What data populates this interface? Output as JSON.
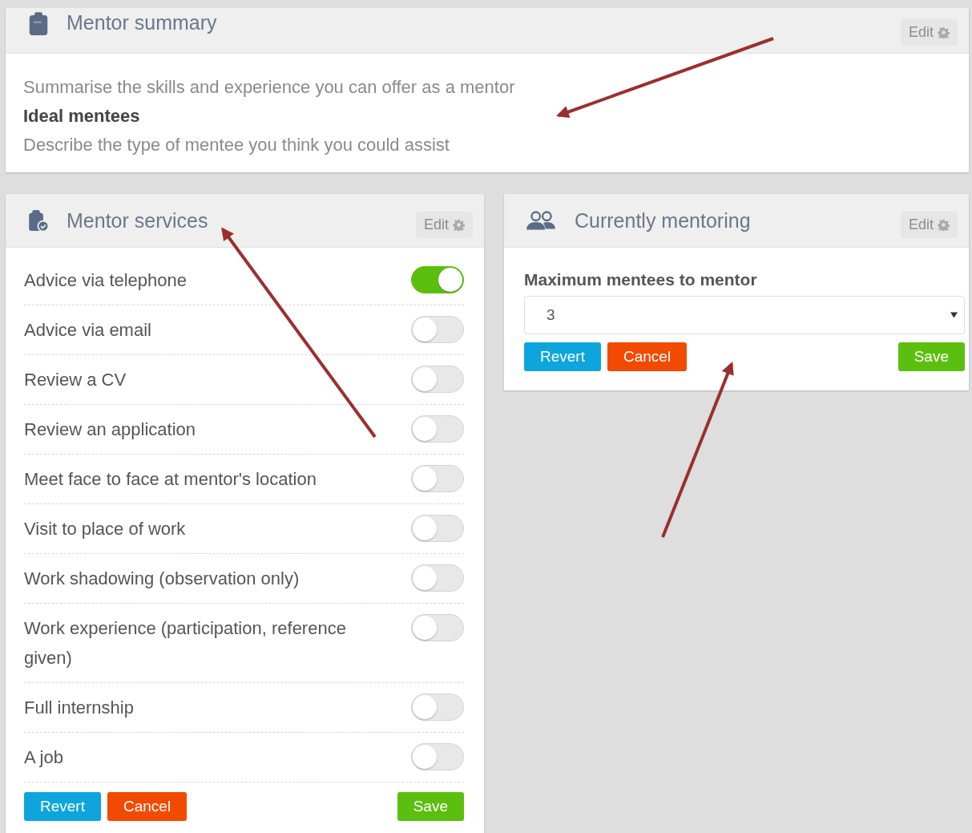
{
  "summary": {
    "title": "Mentor summary",
    "edit": "Edit",
    "lines": [
      {
        "text": "Summarise the skills and experience you can offer as a mentor",
        "kind": "hint"
      },
      {
        "text": "Ideal mentees",
        "kind": "heading"
      },
      {
        "text": "Describe the type of mentee you think you could assist",
        "kind": "hint"
      }
    ]
  },
  "services": {
    "title": "Mentor services",
    "edit": "Edit",
    "items": [
      {
        "label": "Advice via telephone",
        "on": true
      },
      {
        "label": "Advice via email",
        "on": false
      },
      {
        "label": "Review a CV",
        "on": false
      },
      {
        "label": "Review an application",
        "on": false
      },
      {
        "label": "Meet face to face at mentor's location",
        "on": false
      },
      {
        "label": "Visit to place of work",
        "on": false
      },
      {
        "label": "Work shadowing (observation only)",
        "on": false
      },
      {
        "label": "Work experience (participation, reference given)",
        "on": false
      },
      {
        "label": "Full internship",
        "on": false
      },
      {
        "label": "A job",
        "on": false
      }
    ],
    "buttons": [
      {
        "label": "Revert",
        "kind": "revert"
      },
      {
        "label": "Cancel",
        "kind": "cancel"
      },
      {
        "label": "Save",
        "kind": "save"
      }
    ]
  },
  "mentoring": {
    "title": "Currently mentoring",
    "edit": "Edit",
    "field_label": "Maximum mentees to mentor",
    "select": {
      "value": "3"
    },
    "buttons": [
      {
        "label": "Revert",
        "kind": "revert"
      },
      {
        "label": "Cancel",
        "kind": "cancel"
      },
      {
        "label": "Save",
        "kind": "save"
      }
    ]
  }
}
